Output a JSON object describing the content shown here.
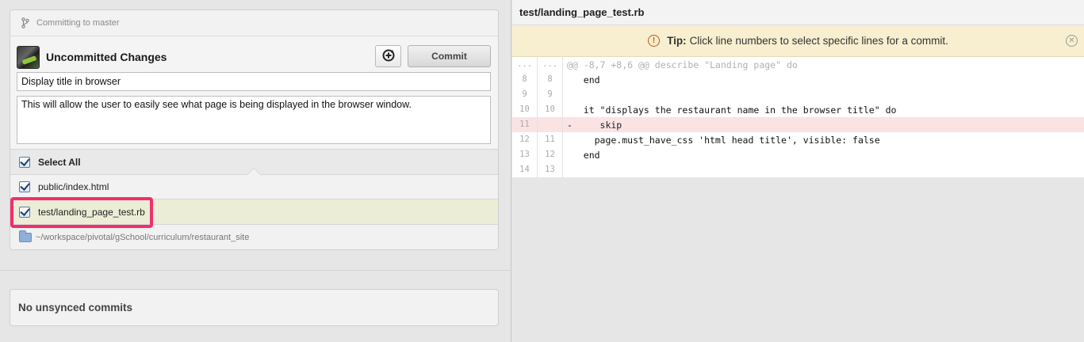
{
  "left": {
    "branch_label": "Committing to master",
    "header_title": "Uncommitted Changes",
    "commit_button": "Commit",
    "summary_value": "Display title in browser",
    "description_value": "This will allow the user to easily see what page is being displayed in the browser window.",
    "select_all_label": "Select All",
    "files": [
      {
        "name": "public/index.html",
        "checked": true
      },
      {
        "name": "test/landing_page_test.rb",
        "checked": true
      }
    ],
    "repo_path": "~/workspace/pivotal/gSchool/curriculum/restaurant_site",
    "unsynced_label": "No unsynced commits"
  },
  "right": {
    "file_title": "test/landing_page_test.rb",
    "tip_label": "Tip:",
    "tip_text": "Click line numbers to select specific lines for a commit.",
    "diff": [
      {
        "n1": "...",
        "n2": "...",
        "code": "@@ -8,7 +8,6 @@ describe \"Landing page\" do",
        "kind": "hunk"
      },
      {
        "n1": "8",
        "n2": "8",
        "code": "   end",
        "kind": "ctx"
      },
      {
        "n1": "9",
        "n2": "9",
        "code": "",
        "kind": "ctx"
      },
      {
        "n1": "10",
        "n2": "10",
        "code": "   it \"displays the restaurant name in the browser title\" do",
        "kind": "ctx"
      },
      {
        "n1": "11",
        "n2": "",
        "code": "-     skip",
        "kind": "del"
      },
      {
        "n1": "12",
        "n2": "11",
        "code": "     page.must_have_css 'html head title', visible: false",
        "kind": "ctx"
      },
      {
        "n1": "13",
        "n2": "12",
        "code": "   end",
        "kind": "ctx"
      },
      {
        "n1": "14",
        "n2": "13",
        "code": "",
        "kind": "ctx"
      }
    ]
  }
}
